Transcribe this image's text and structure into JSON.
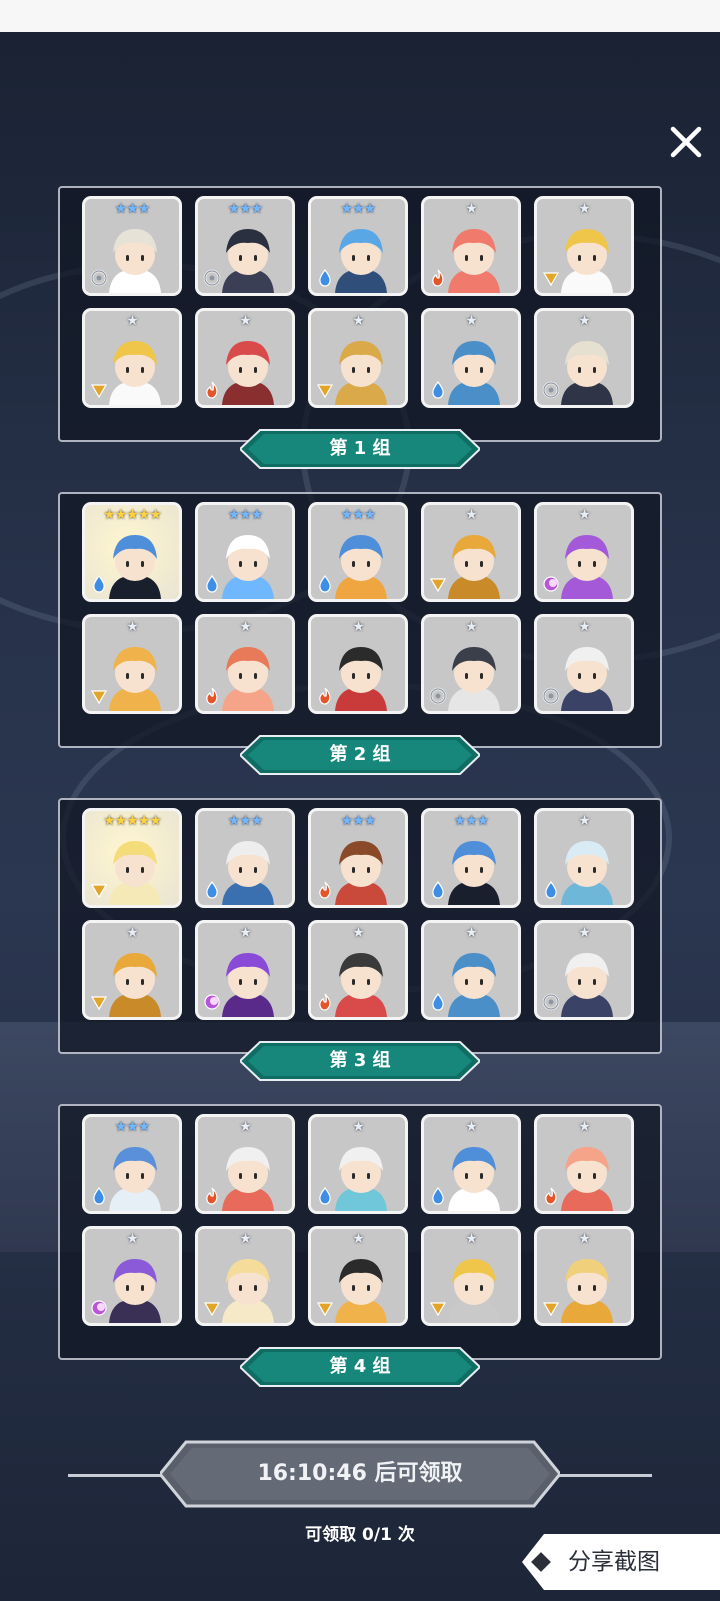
{
  "colors": {
    "accent_teal": "#16857a",
    "panel_border": "#e1e6f0",
    "card_bg": "#c7c7c7",
    "water": "#3e8ee6",
    "fire": "#e5552a",
    "light": "#e2a52a",
    "dark": "#b855d8",
    "wind": "#8f96a3"
  },
  "close_icon": "close-icon",
  "groups": [
    {
      "label": "第 1 组",
      "heroes": [
        {
          "stars": 3,
          "element": "wind",
          "hair": "#e6e2d8",
          "outfit": "#ffffff"
        },
        {
          "stars": 3,
          "element": "wind",
          "hair": "#2b3040",
          "outfit": "#3a3f55"
        },
        {
          "stars": 3,
          "element": "water",
          "hair": "#5aa7e6",
          "outfit": "#2f4f7a"
        },
        {
          "stars": 1,
          "element": "fire",
          "hair": "#f07a6b",
          "outfit": "#f07a6b"
        },
        {
          "stars": 1,
          "element": "light",
          "hair": "#f0c64a",
          "outfit": "#fafafa"
        },
        {
          "stars": 1,
          "element": "light",
          "hair": "#f0c64a",
          "outfit": "#fafafa"
        },
        {
          "stars": 1,
          "element": "fire",
          "hair": "#d94a4a",
          "outfit": "#8a2f2f"
        },
        {
          "stars": 1,
          "element": "light",
          "hair": "#d9a94a",
          "outfit": "#d9a94a"
        },
        {
          "stars": 1,
          "element": "water",
          "hair": "#4a8fc7",
          "outfit": "#4a8fc7"
        },
        {
          "stars": 1,
          "element": "wind",
          "hair": "#e6e0d0",
          "outfit": "#2f3446"
        }
      ]
    },
    {
      "label": "第 2 组",
      "heroes": [
        {
          "stars": 5,
          "element": "water",
          "hair": "#4f8fd9",
          "outfit": "#1a1f2e",
          "gold": true
        },
        {
          "stars": 3,
          "element": "water",
          "hair": "#ffffff",
          "outfit": "#6fb7ff"
        },
        {
          "stars": 3,
          "element": "water",
          "hair": "#4f8fd9",
          "outfit": "#f0a640"
        },
        {
          "stars": 1,
          "element": "light",
          "hair": "#e8a83a",
          "outfit": "#c98a2a"
        },
        {
          "stars": 1,
          "element": "dark",
          "hair": "#a45ad8",
          "outfit": "#a45ad8"
        },
        {
          "stars": 1,
          "element": "light",
          "hair": "#f0b24a",
          "outfit": "#f0b24a"
        },
        {
          "stars": 1,
          "element": "fire",
          "hair": "#e87a5a",
          "outfit": "#f5a48a"
        },
        {
          "stars": 1,
          "element": "fire",
          "hair": "#2b2b2b",
          "outfit": "#c93a3a"
        },
        {
          "stars": 1,
          "element": "wind",
          "hair": "#3a3f4a",
          "outfit": "#e6e6e6"
        },
        {
          "stars": 1,
          "element": "wind",
          "hair": "#f0f0f0",
          "outfit": "#3a4266"
        }
      ]
    },
    {
      "label": "第 3 组",
      "heroes": [
        {
          "stars": 5,
          "element": "light",
          "hair": "#f5dc7a",
          "outfit": "#f5e9b8",
          "gold": true
        },
        {
          "stars": 3,
          "element": "water",
          "hair": "#eeeeee",
          "outfit": "#3a70b0"
        },
        {
          "stars": 3,
          "element": "fire",
          "hair": "#8a4a2a",
          "outfit": "#c94a3a"
        },
        {
          "stars": 3,
          "element": "water",
          "hair": "#4f8fd9",
          "outfit": "#1a1f2e"
        },
        {
          "stars": 1,
          "element": "water",
          "hair": "#d9ecf5",
          "outfit": "#6fb7d9"
        },
        {
          "stars": 1,
          "element": "light",
          "hair": "#e8a83a",
          "outfit": "#c98a2a"
        },
        {
          "stars": 1,
          "element": "dark",
          "hair": "#8a4ad8",
          "outfit": "#5a2a8a"
        },
        {
          "stars": 1,
          "element": "fire",
          "hair": "#3a3a3a",
          "outfit": "#d94a4a"
        },
        {
          "stars": 1,
          "element": "water",
          "hair": "#4a8fc7",
          "outfit": "#4a8fc7"
        },
        {
          "stars": 1,
          "element": "wind",
          "hair": "#f0f0f0",
          "outfit": "#3a4266"
        }
      ]
    },
    {
      "label": "第 4 组",
      "heroes": [
        {
          "stars": 3,
          "element": "water",
          "hair": "#5a8fd9",
          "outfit": "#e6eef6"
        },
        {
          "stars": 1,
          "element": "fire",
          "hair": "#f0f0f0",
          "outfit": "#e86a5a"
        },
        {
          "stars": 1,
          "element": "water",
          "hair": "#f0f0f0",
          "outfit": "#6fc7d9"
        },
        {
          "stars": 1,
          "element": "water",
          "hair": "#4f8fd9",
          "outfit": "#ffffff"
        },
        {
          "stars": 1,
          "element": "fire",
          "hair": "#f5a48a",
          "outfit": "#e86a5a"
        },
        {
          "stars": 1,
          "element": "dark",
          "hair": "#8a5ad8",
          "outfit": "#3a2f55"
        },
        {
          "stars": 1,
          "element": "light",
          "hair": "#f5dc9a",
          "outfit": "#f5e9c8"
        },
        {
          "stars": 1,
          "element": "light",
          "hair": "#2b2b2b",
          "outfit": "#f0b24a"
        },
        {
          "stars": 1,
          "element": "light",
          "hair": "#f0c64a",
          "outfit": "#c9c9c9"
        },
        {
          "stars": 1,
          "element": "light",
          "hair": "#f0d07a",
          "outfit": "#e8a83a"
        }
      ]
    }
  ],
  "footer": {
    "timer": "16:10:46 后可领取",
    "claim_count": "可领取 0/1 次",
    "share_label": "分享截图"
  }
}
